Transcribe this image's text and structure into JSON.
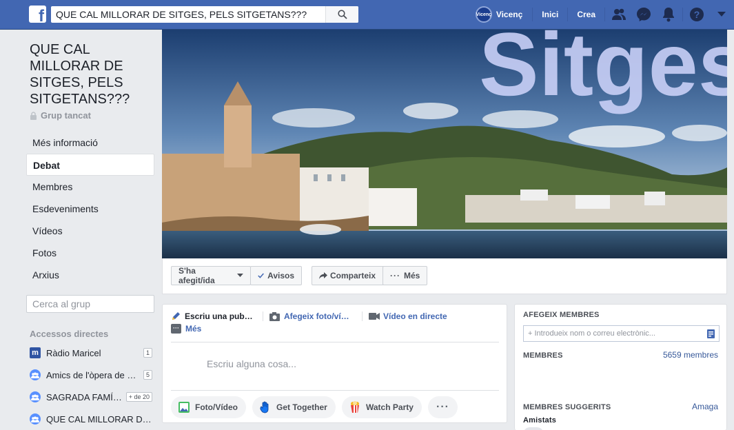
{
  "topbar": {
    "search_value": "QUE CAL MILLORAR DE SITGES, PELS SITGETANS???",
    "user_name": "Vicenç",
    "avatar_text": "Vicenç",
    "home_label": "Inici",
    "create_label": "Crea",
    "brand_color": "#4267b2"
  },
  "group": {
    "title": "QUE CAL MILLORAR DE SITGES, PELS SITGETANS???",
    "privacy": "Grup tancat"
  },
  "left_nav": {
    "items": [
      "Més informació",
      "Debat",
      "Membres",
      "Esdeveniments",
      "Vídeos",
      "Fotos",
      "Arxius"
    ],
    "active": "Debat"
  },
  "group_search": {
    "placeholder": "Cerca al grup"
  },
  "shortcuts": {
    "title": "Accessos directes",
    "items": [
      {
        "label": "Ràdio Maricel",
        "badge": "1",
        "icon": "radio-logo-icon"
      },
      {
        "label": "Amics de l'òpera de Sabadell",
        "badge": "5",
        "icon": "group-icon"
      },
      {
        "label": "SAGRADA FAMÍLIA",
        "badge": "+ de 20",
        "icon": "group-icon"
      },
      {
        "label": "QUE CAL MILLORAR DE SITGES",
        "badge": "",
        "icon": "group-icon"
      }
    ]
  },
  "cover": {
    "overlay_text": "Sitges"
  },
  "cover_actions": {
    "joined_label": "S'ha afegit/ida",
    "notifications_label": "Avisos",
    "share_label": "Comparteix",
    "more_label": "Més"
  },
  "composer": {
    "tab_write": "Escriu una pub…",
    "tab_photo": "Afegeix foto/ví…",
    "tab_live": "Vídeo en directe",
    "tab_more": "Més",
    "placeholder": "Escriu alguna cosa...",
    "pill_photo": "Foto/Vídeo",
    "pill_together": "Get Together",
    "pill_watch": "Watch Party"
  },
  "sidebar": {
    "add_members_title": "AFEGEIX MEMBRES",
    "add_members_placeholder": "+ Introdueix nom o correu electrònic...",
    "members_title": "MEMBRES",
    "members_count": "5659 membres",
    "suggested_title": "MEMBRES SUGGERITS",
    "hide_label": "Amaga",
    "friends_label": "Amistats"
  }
}
